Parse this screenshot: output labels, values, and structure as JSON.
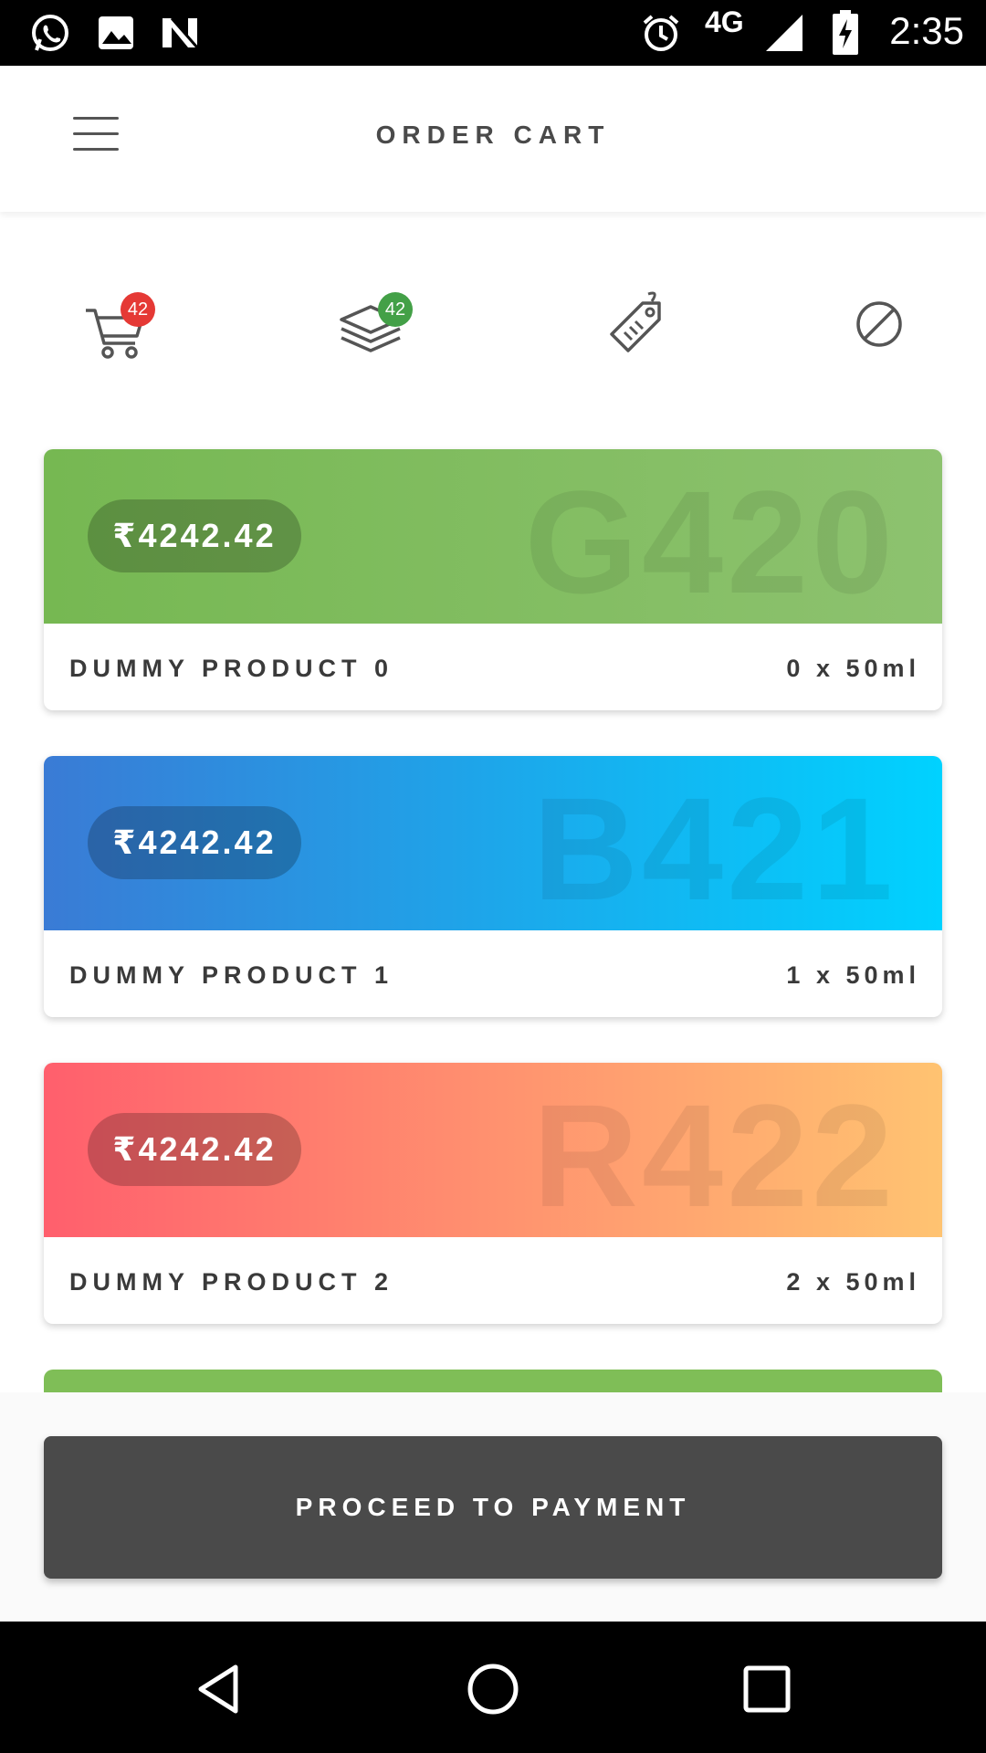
{
  "status_bar": {
    "time": "2:35",
    "network": "4G",
    "icons": [
      "whatsapp-icon",
      "image-icon",
      "n-logo-icon",
      "alarm-icon",
      "signal-icon",
      "battery-charging-icon"
    ]
  },
  "header": {
    "title": "ORDER CART",
    "menu_icon": "hamburger-menu-icon"
  },
  "tabs": [
    {
      "icon": "cart-icon",
      "badge": "42",
      "badge_color": "#e53935"
    },
    {
      "icon": "layers-icon",
      "badge": "42",
      "badge_color": "#43a047"
    },
    {
      "icon": "tag-icon",
      "badge": ""
    },
    {
      "icon": "cancel-icon",
      "badge": ""
    }
  ],
  "cards": [
    {
      "code": "G420",
      "price": "₹4242.42",
      "name": "DUMMY PRODUCT 0",
      "qty": "0 x 50ml",
      "gradient": [
        "#76b852",
        "#8dc26f"
      ]
    },
    {
      "code": "B421",
      "price": "₹4242.42",
      "name": "DUMMY PRODUCT 1",
      "qty": "1 x 50ml",
      "gradient": [
        "#3a7bd5",
        "#00d2ff"
      ]
    },
    {
      "code": "R422",
      "price": "₹4242.42",
      "name": "DUMMY PRODUCT 2",
      "qty": "2 x 50ml",
      "gradient": [
        "#ff5f6d",
        "#ffc371"
      ]
    }
  ],
  "footer": {
    "pay_button": "PROCEED TO PAYMENT"
  },
  "nav_bar": {
    "icons": [
      "back-icon",
      "home-icon",
      "recents-icon"
    ]
  }
}
